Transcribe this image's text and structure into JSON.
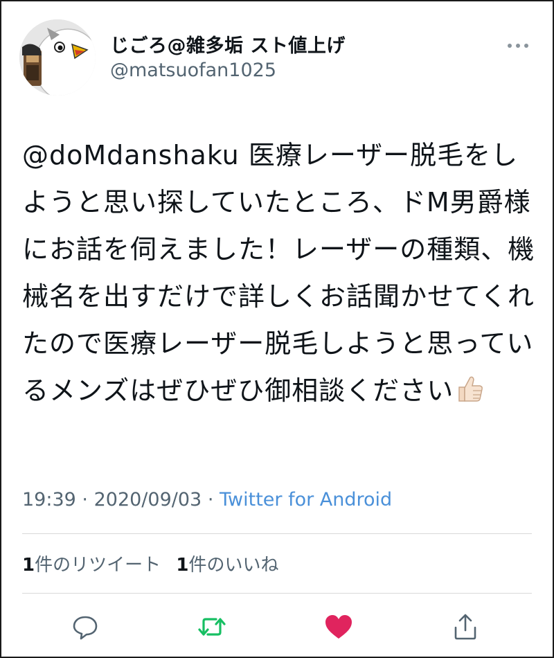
{
  "tweet": {
    "author": {
      "display_name": "じごろ@雑多垢 スト値上げ",
      "handle": "@matsuofan1025",
      "avatar_icon": "bird-avatar-icon"
    },
    "mention": "@doMdanshaku",
    "text_lines": [
      "医療レーザー脱毛",
      "をしようと思い探していたところ、",
      "ドM男爵様にお話を伺えました！レ",
      "ーザーの種類、機械名を出すだけで",
      "詳しくお話聞かせてくれたので医療",
      "レーザー脱毛しようと思っているメ",
      "ンズはぜひぜひ御相談ください"
    ],
    "emoji": "thumbs-up-icon",
    "time": "19:39",
    "separator": "·",
    "date": "2020/09/03",
    "source": "Twitter for Android",
    "retweets": {
      "count": "1",
      "label": "件のリツイート"
    },
    "likes": {
      "count": "1",
      "label": "件のいいね"
    }
  },
  "actions": [
    {
      "name": "reply",
      "icon": "speech-bubble-icon",
      "color": "#536471"
    },
    {
      "name": "retweet",
      "icon": "retweet-icon",
      "color": "#17bf63"
    },
    {
      "name": "like",
      "icon": "heart-icon",
      "color": "#e0245e"
    },
    {
      "name": "share",
      "icon": "share-icon",
      "color": "#536471"
    }
  ],
  "colors": {
    "text": "#0f1419",
    "secondary": "#536471",
    "link": "#4a90d9",
    "retweeted": "#17bf63",
    "liked": "#e0245e"
  }
}
